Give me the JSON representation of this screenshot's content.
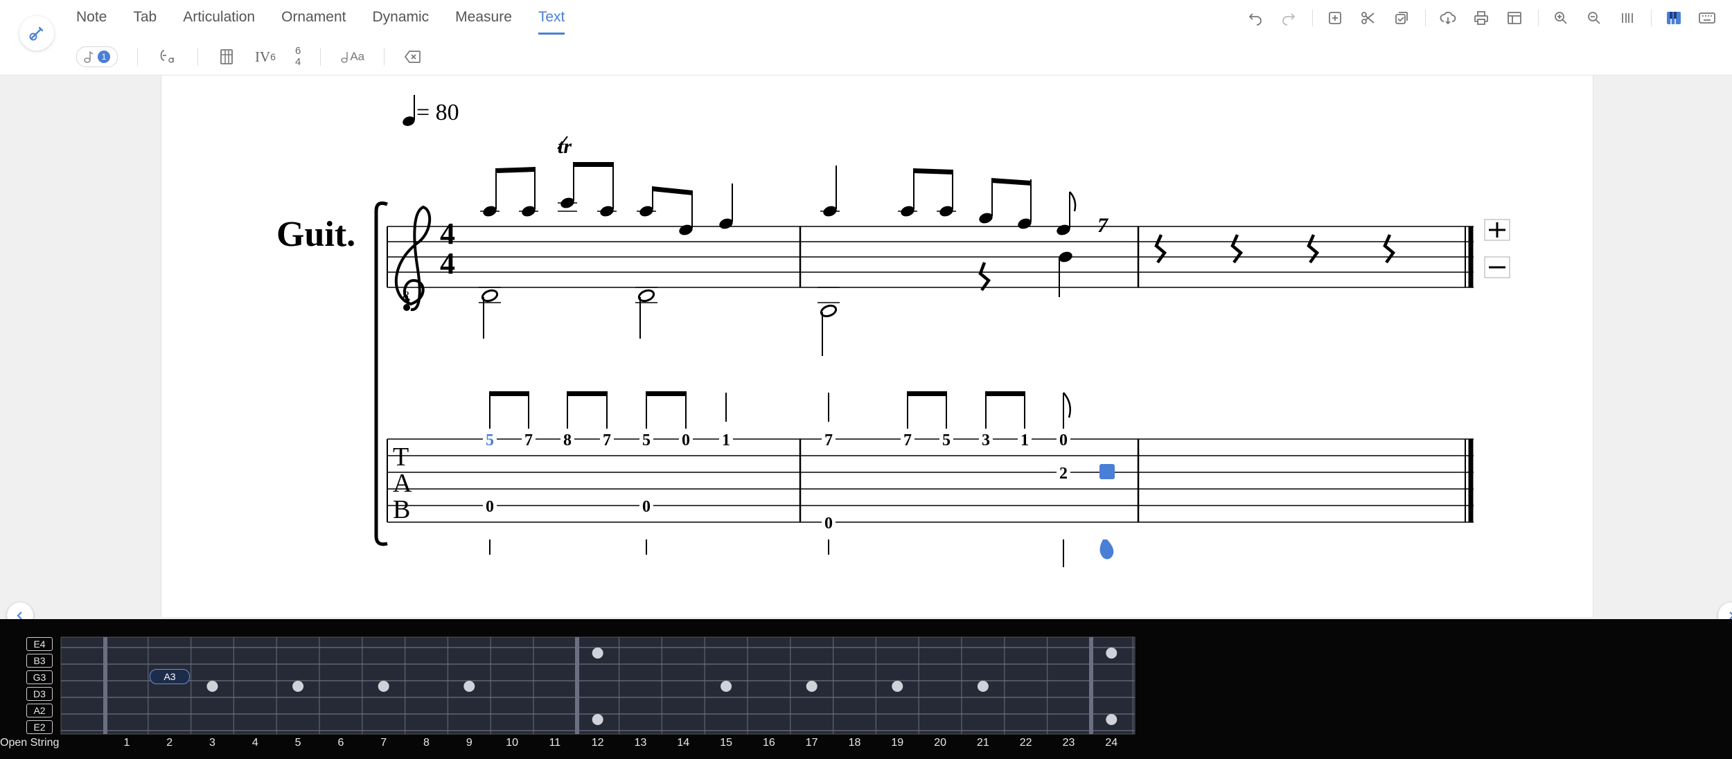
{
  "menu": [
    {
      "label": "Note",
      "active": false
    },
    {
      "label": "Tab",
      "active": false
    },
    {
      "label": "Articulation",
      "active": false
    },
    {
      "label": "Ornament",
      "active": false
    },
    {
      "label": "Dynamic",
      "active": false
    },
    {
      "label": "Measure",
      "active": false
    },
    {
      "label": "Text",
      "active": true
    }
  ],
  "toolbar_right": [
    "undo-icon",
    "redo-icon",
    "add-measure-icon",
    "cut-icon",
    "copy-icon",
    "download-icon",
    "print-icon",
    "layout-icon",
    "zoom-in-icon",
    "zoom-out-icon",
    "bars-icon",
    "piano-mode-icon",
    "keyboard-icon"
  ],
  "subtools": {
    "voice_badge": "1",
    "roman_numeral": "IV",
    "roman_sup": "6",
    "figured_top": "6",
    "figured_bottom": "4",
    "lyric_text": "Aa"
  },
  "score": {
    "tempo": "= 80",
    "instrument": "Guit.",
    "trill": "tr",
    "time_sig_top": "4",
    "time_sig_bottom": "4",
    "clef_octave": "8",
    "tab_letters": [
      "T",
      "A",
      "B"
    ],
    "tab_numbers": {
      "string1": [
        "5",
        "7",
        "8",
        "7",
        "5",
        "0",
        "1",
        "7",
        "7",
        "5",
        "3",
        "1",
        "0"
      ],
      "string3": [
        "2"
      ],
      "string5": [
        "0",
        "0"
      ],
      "string6": [
        "0"
      ]
    }
  },
  "fretboard": {
    "strings": [
      "E4",
      "B3",
      "G3",
      "D3",
      "A2",
      "E2"
    ],
    "open_label": "Open String",
    "frets": [
      "1",
      "2",
      "3",
      "4",
      "5",
      "6",
      "7",
      "8",
      "9",
      "10",
      "11",
      "12",
      "13",
      "14",
      "15",
      "16",
      "17",
      "18",
      "19",
      "20",
      "21",
      "22",
      "23",
      "24"
    ],
    "selected_note": "A3"
  },
  "colors": {
    "accent": "#4a7fd6",
    "highlight_note": "#4a7fd6"
  }
}
